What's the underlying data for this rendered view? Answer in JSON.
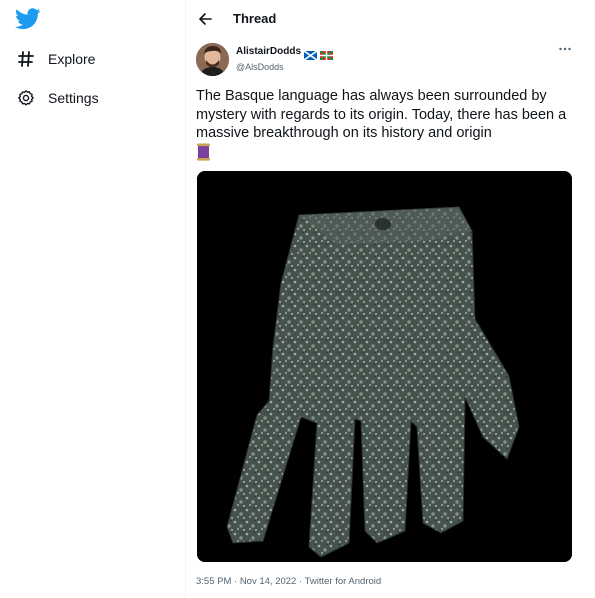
{
  "sidebar": {
    "logo_icon": "twitter-bird-icon",
    "brand_color": "#1d9bf0",
    "items": [
      {
        "icon": "hashtag-icon",
        "label": "Explore"
      },
      {
        "icon": "gear-icon",
        "label": "Settings"
      }
    ]
  },
  "header": {
    "back_icon": "arrow-left-icon",
    "title": "Thread"
  },
  "tweet": {
    "display_name": "AlistairDodds",
    "flags": [
      "scotland-flag-icon",
      "basque-flag-icon"
    ],
    "handle": "@AlsDodds",
    "more_icon": "more-horizontal-icon",
    "text": "The Basque language has always been surrounded by mystery with regards to its origin. Today, there has been a massive breakthrough on its history and origin",
    "text_emoji": "scroll-emoji-icon",
    "image": "bronze-hand-artifact-photo",
    "timestamp": "3:55 PM · Nov 14, 2022 · Twitter for Android"
  }
}
